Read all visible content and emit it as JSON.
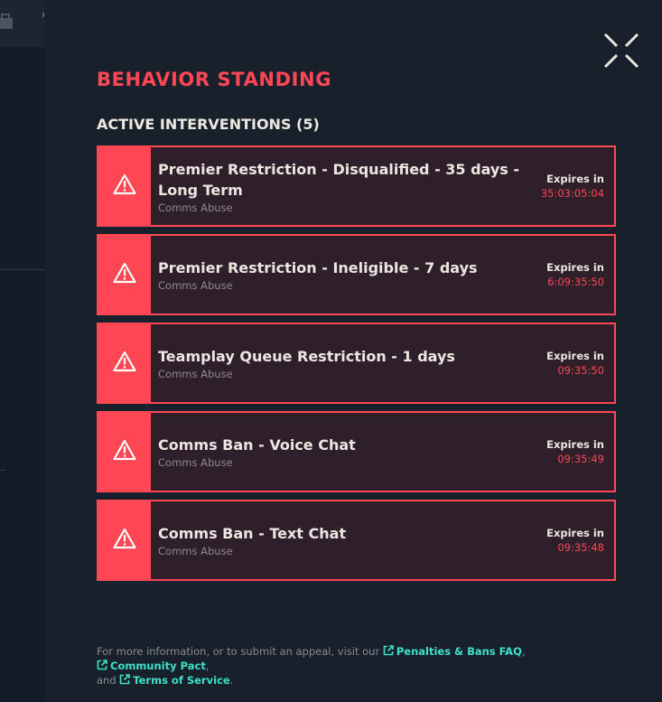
{
  "colors": {
    "accent": "#ff4655",
    "link": "#3fe0c8",
    "card_bg": "#2f1f2a",
    "panel_bg": "#18212b"
  },
  "icons": {
    "close": "close-x-icon",
    "warning": "warning-triangle-icon",
    "external": "external-link-icon"
  },
  "title": "BEHAVIOR STANDING",
  "subtitle": "ACTIVE INTERVENTIONS (5)",
  "interventions": [
    {
      "name": "Premier Restriction - Disqualified - 35 days - Long Term",
      "reason": "Comms Abuse",
      "expires_label": "Expires in",
      "expires_time": "35:03:05:04"
    },
    {
      "name": "Premier Restriction - Ineligible - 7 days",
      "reason": "Comms Abuse",
      "expires_label": "Expires in",
      "expires_time": "6:09:35:50"
    },
    {
      "name": "Teamplay Queue Restriction - 1 days",
      "reason": "Comms Abuse",
      "expires_label": "Expires in",
      "expires_time": "09:35:50"
    },
    {
      "name": "Comms Ban - Voice Chat",
      "reason": "Comms Abuse",
      "expires_label": "Expires in",
      "expires_time": "09:35:49"
    },
    {
      "name": "Comms Ban - Text Chat",
      "reason": "Comms Abuse",
      "expires_label": "Expires in",
      "expires_time": "09:35:48"
    }
  ],
  "footer": {
    "text_1": "For more information, or to submit an appeal, visit our ",
    "link_1": "Penalties & Bans FAQ",
    "sep_1": ", ",
    "link_2": "Community Pact",
    "sep_2": ",",
    "text_2": "and ",
    "link_3": "Terms of Service",
    "end": "."
  }
}
